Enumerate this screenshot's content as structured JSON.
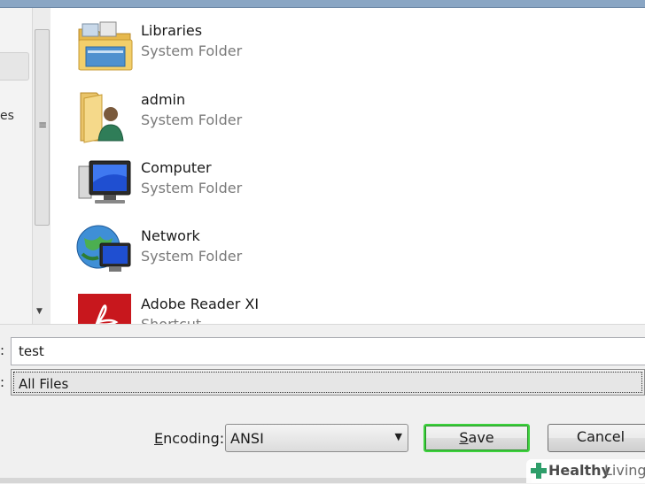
{
  "file_list": {
    "items": [
      {
        "name": "Libraries",
        "type": "System Folder",
        "icon": "libraries-folder-icon"
      },
      {
        "name": "admin",
        "type": "System Folder",
        "icon": "user-folder-icon"
      },
      {
        "name": "Computer",
        "type": "System Folder",
        "icon": "computer-icon"
      },
      {
        "name": "Network",
        "type": "System Folder",
        "icon": "network-icon"
      },
      {
        "name": "Adobe Reader XI",
        "type": "Shortcut",
        "icon": "adobe-reader-icon"
      }
    ]
  },
  "nav_pane": {
    "fragment": "es"
  },
  "form": {
    "filename_label_fragment": ":",
    "filename_value": "test",
    "type_label_fragment": ":",
    "type_value": "All Files",
    "encoding_label_pre": "",
    "encoding_label_u": "E",
    "encoding_label_post": "ncoding:",
    "encoding_value": "ANSI"
  },
  "buttons": {
    "save_u": "S",
    "save_rest": "ave",
    "cancel": "Cancel"
  },
  "watermark": {
    "part1": "Healthy",
    "part2": "Living"
  },
  "colors": {
    "save_focus": "#3cd13c",
    "title_bar": "#8aa6c4",
    "adobe_red": "#c8171d"
  }
}
